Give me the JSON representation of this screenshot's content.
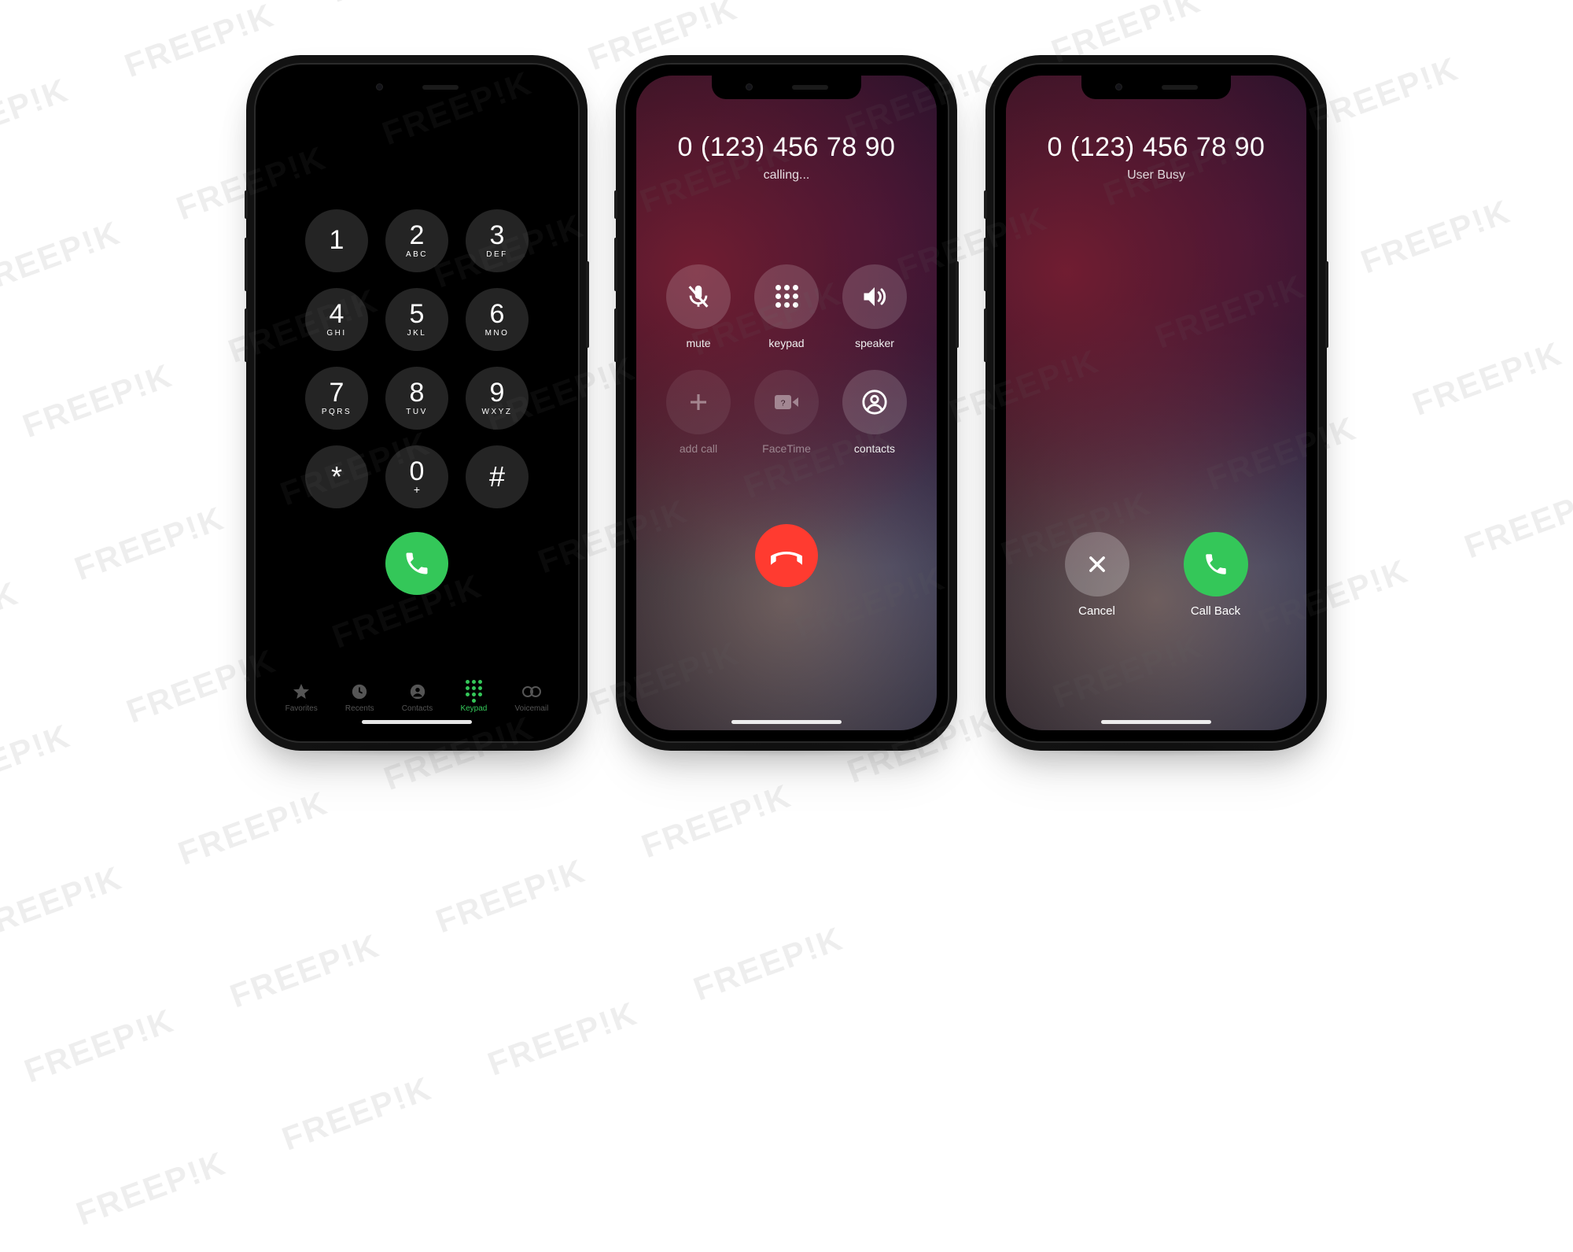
{
  "watermark_text": "FREEP!K",
  "dialer": {
    "keys": [
      {
        "digit": "1",
        "letters": ""
      },
      {
        "digit": "2",
        "letters": "ABC"
      },
      {
        "digit": "3",
        "letters": "DEF"
      },
      {
        "digit": "4",
        "letters": "GHI"
      },
      {
        "digit": "5",
        "letters": "JKL"
      },
      {
        "digit": "6",
        "letters": "MNO"
      },
      {
        "digit": "7",
        "letters": "PQRS"
      },
      {
        "digit": "8",
        "letters": "TUV"
      },
      {
        "digit": "9",
        "letters": "WXYZ"
      },
      {
        "digit": "*",
        "letters": ""
      },
      {
        "digit": "0",
        "letters": "+"
      },
      {
        "digit": "#",
        "letters": ""
      }
    ],
    "tabs": [
      {
        "label": "Favorites",
        "active": false
      },
      {
        "label": "Recents",
        "active": false
      },
      {
        "label": "Contacts",
        "active": false
      },
      {
        "label": "Keypad",
        "active": true
      },
      {
        "label": "Voicemail",
        "active": false
      }
    ]
  },
  "calling": {
    "number": "0 (123) 456 78 90",
    "status": "calling...",
    "controls": [
      {
        "name": "mute",
        "label": "mute",
        "dim": false
      },
      {
        "name": "keypad",
        "label": "keypad",
        "dim": false
      },
      {
        "name": "speaker",
        "label": "speaker",
        "dim": false
      },
      {
        "name": "add-call",
        "label": "add call",
        "dim": true
      },
      {
        "name": "facetime",
        "label": "FaceTime",
        "dim": true
      },
      {
        "name": "contacts",
        "label": "contacts",
        "dim": false
      }
    ]
  },
  "busy": {
    "number": "0 (123) 456 78 90",
    "status": "User Busy",
    "cancel_label": "Cancel",
    "callback_label": "Call Back"
  },
  "colors": {
    "green": "#34c759",
    "red": "#ff3b30"
  }
}
